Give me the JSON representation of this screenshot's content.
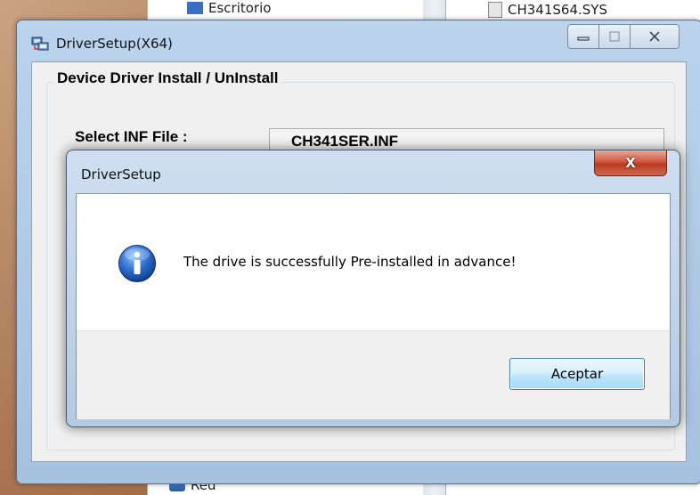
{
  "background_explorer": {
    "item_escritorio": "Escritorio",
    "item_sys_file": "CH341S64.SYS",
    "item_red": "Red"
  },
  "main_window": {
    "title": "DriverSetup(X64)",
    "group_title": "Device Driver Install / UnInstall",
    "inf_label": "Select INF File :",
    "inf_value": "CH341SER.INF"
  },
  "dialog": {
    "title": "DriverSetup",
    "message": "The drive is successfully Pre-installed in advance!",
    "ok_label": "Aceptar",
    "close_glyph": "X",
    "icon": "info-icon"
  },
  "colors": {
    "accent_button": "#3c7fb1",
    "close_red": "#c94a33",
    "info_blue": "#1f5fbf"
  }
}
